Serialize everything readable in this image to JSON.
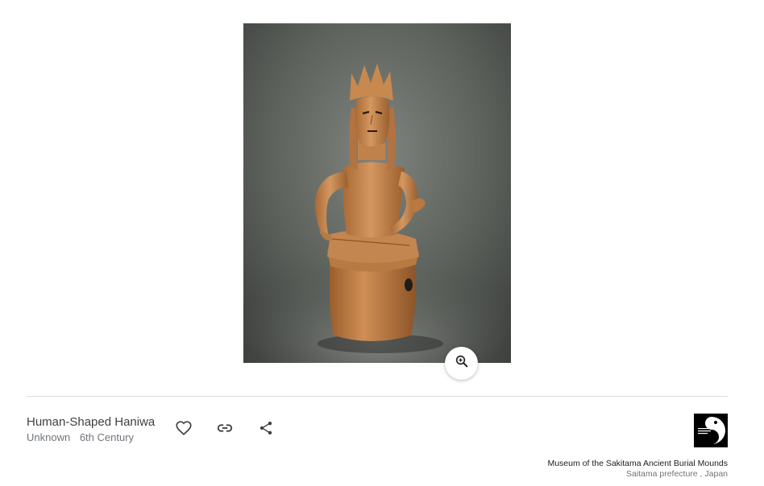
{
  "artwork": {
    "title": "Human-Shaped Haniwa",
    "creator": "Unknown",
    "date": "6th Century",
    "image_alt": "Human-Shaped Haniwa"
  },
  "actions": {
    "zoom_icon": "zoom-in-icon",
    "like_icon": "heart-icon",
    "link_icon": "link-icon",
    "share_icon": "share-icon"
  },
  "museum": {
    "name": "Museum of the Sakitama Ancient Burial Mounds",
    "location": "Saitama prefecture , Japan",
    "logo_icon": "museum-logo"
  },
  "colors": {
    "background": "#ffffff",
    "text_primary": "#3c4043",
    "text_secondary": "#70757a",
    "divider": "#dadce0",
    "clay": "#c98a4e"
  }
}
